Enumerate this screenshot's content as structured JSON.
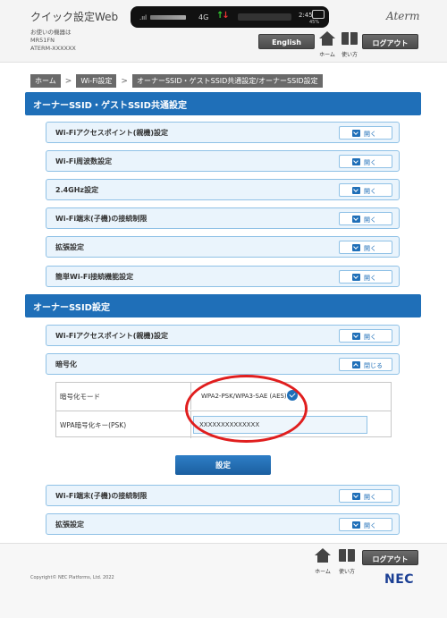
{
  "header": {
    "app_title": "クイック設定Web",
    "device_info": [
      "お使いの機器は",
      "MR51FN",
      "ATERM-XXXXXX"
    ],
    "status": {
      "network": "4G",
      "time": "2:45",
      "battery": "45%"
    },
    "brand": "Aterm",
    "english_label": "English",
    "home_label": "ホーム",
    "manual_label": "使い方",
    "logout_label": "ログアウト"
  },
  "breadcrumb": [
    "ホーム",
    "Wi-Fi設定",
    "オーナーSSID・ゲストSSID共通設定/オーナーSSID設定"
  ],
  "sections": {
    "common": {
      "title": "オーナーSSID・ゲストSSID共通設定",
      "items": [
        {
          "label": "Wi-Fiアクセスポイント(親機)設定",
          "button": "開く"
        },
        {
          "label": "Wi-Fi周波数設定",
          "button": "開く"
        },
        {
          "label": "2.4GHz設定",
          "button": "開く"
        },
        {
          "label": "Wi-Fi端末(子機)の接続制限",
          "button": "開く"
        },
        {
          "label": "拡張設定",
          "button": "開く"
        },
        {
          "label": "簡単Wi-Fi接続機能設定",
          "button": "開く"
        }
      ]
    },
    "owner": {
      "title": "オーナーSSID設定",
      "items": [
        {
          "label": "Wi-Fiアクセスポイント(親機)設定",
          "button": "開く"
        },
        {
          "label": "暗号化",
          "button": "閉じる"
        }
      ],
      "encryption": {
        "mode_label": "暗号化モード",
        "mode_value": "WPA2-PSK/WPA3-SAE (AES)",
        "key_label": "WPA暗号化キー(PSK)",
        "key_value": "XXXXXXXXXXXXXX"
      },
      "set_button": "設定",
      "items_after": [
        {
          "label": "Wi-Fi端末(子機)の接続制限",
          "button": "開く"
        },
        {
          "label": "拡張設定",
          "button": "開く"
        }
      ]
    }
  },
  "footer": {
    "home_label": "ホーム",
    "manual_label": "使い方",
    "logout_label": "ログアウト",
    "copyright": "Copyright© NEC Platforms, Ltd. 2022",
    "logo": "NEC"
  },
  "colors": {
    "accent": "#1f6fb8",
    "highlight": "#e01e1e"
  }
}
